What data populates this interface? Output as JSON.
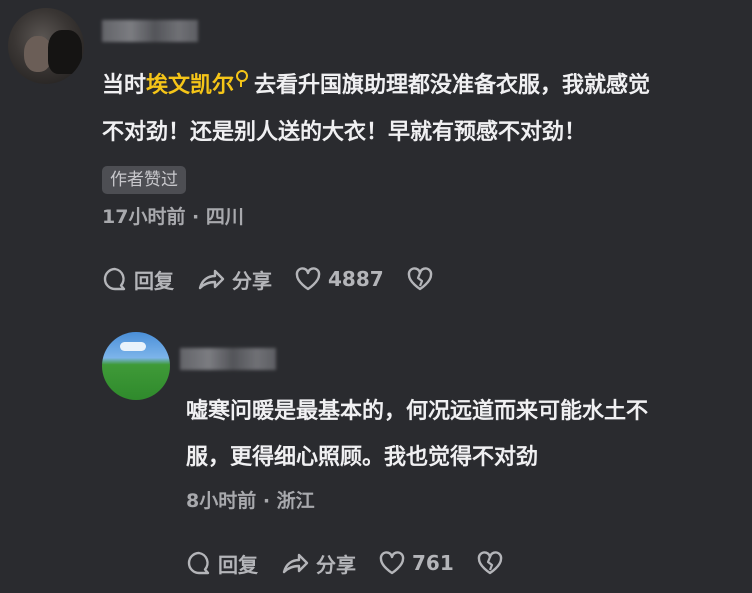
{
  "comment": {
    "username": "",
    "text_line1_prefix": "当时",
    "text_line1_highlight": "埃文凯尔",
    "text_line1_suffix": "去看升国旗助理都没准备衣服，我就感觉",
    "text_line2": "不对劲！还是别人送的大衣！早就有预感不对劲！",
    "badge": "作者赞过",
    "meta": "17小时前 · 四川",
    "actions": {
      "reply_label": "回复",
      "share_label": "分享",
      "like_count": "4887"
    }
  },
  "reply": {
    "username": "",
    "text_line1": "嘘寒问暖是最基本的，何况远道而来可能水土不",
    "text_line2": "服，更得细心照顾。我也觉得不对劲",
    "meta": "8小时前 · 浙江",
    "actions": {
      "reply_label": "回复",
      "share_label": "分享",
      "like_count": "761"
    }
  },
  "colors": {
    "background": "#2a2b2f",
    "highlight": "#f5c518",
    "text": "#f0f0f2",
    "meta": "#a8a9ad"
  },
  "icons": [
    "reply-bubble-icon",
    "share-arrow-icon",
    "heart-icon",
    "broken-heart-icon",
    "search-mark-icon"
  ]
}
